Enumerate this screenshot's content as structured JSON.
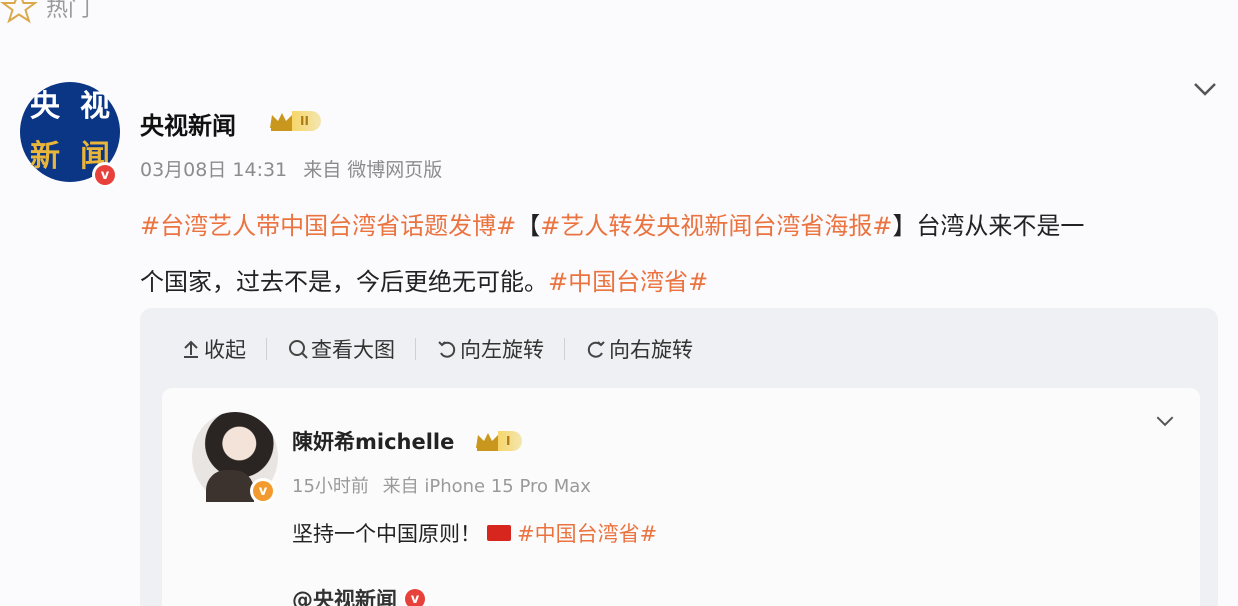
{
  "top_tab": {
    "label": "热门"
  },
  "post": {
    "author": "央视新闻",
    "avatar_chars": [
      "央",
      "视",
      "新",
      "闻"
    ],
    "level": "II",
    "date": "03月08日 14:31",
    "source": "来自 微博网页版",
    "hashtag_1": "#台湾艺人带中国台湾省话题发博#",
    "topic_open": "【",
    "hashtag_2": "#艺人转发央视新闻台湾省海报#",
    "topic_close": "】",
    "text_line1": "台湾从来不是一",
    "text_line2": "个国家，过去不是，今后更绝无可能。",
    "hashtag_3": "#中国台湾省#"
  },
  "toolbar": {
    "collapse": "收起",
    "view_large": "查看大图",
    "rotate_left": "向左旋转",
    "rotate_right": "向右旋转"
  },
  "repost": {
    "author": "陳妍希michelle",
    "level": "I",
    "time": "15小时前",
    "source": "来自 iPhone 15 Pro Max",
    "text": "坚持一个中国原则！",
    "hashtag": "#中国台湾省#",
    "quoted_author": "@央视新闻"
  },
  "colors": {
    "accent": "#eb7340",
    "verified": "#f29a2e",
    "avatar_bg": "#0b3585"
  },
  "icons": [
    "star-icon",
    "crown-icon",
    "verified-badge-icon",
    "chevron-down-icon",
    "collapse-arrow-icon",
    "magnifier-icon",
    "rotate-left-icon",
    "rotate-right-icon",
    "china-flag-icon"
  ]
}
